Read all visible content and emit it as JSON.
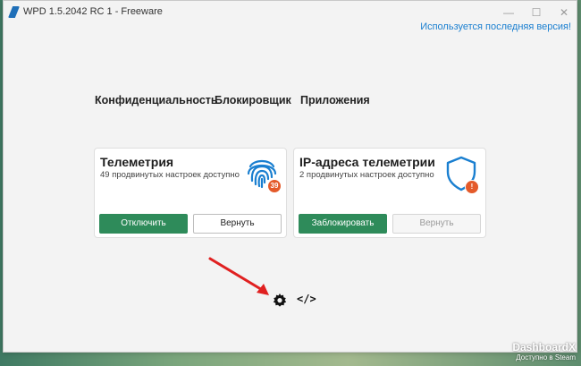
{
  "window": {
    "title": "WPD 1.5.2042 RC 1 - Freeware",
    "update_status": "Используется последняя версия!"
  },
  "nav": {
    "items": [
      {
        "label": "Конфиденциальность"
      },
      {
        "label": "Блокировщик"
      },
      {
        "label": "Приложения"
      }
    ]
  },
  "cards": [
    {
      "title": "Телеметрия",
      "subtitle": "49 продвинутых настроек доступно",
      "icon": "fingerprint-icon",
      "badge": "39",
      "primary_button": "Отключить",
      "secondary_button": "Вернуть"
    },
    {
      "title": "IP-адреса телеметрии",
      "subtitle": "2 продвинутых настроек доступно",
      "icon": "shield-icon",
      "badge": "!",
      "primary_button": "Заблокировать",
      "secondary_button": "Вернуть"
    }
  ],
  "footer_icons": [
    "gear-icon",
    "code-icon"
  ],
  "code_glyph": "</>",
  "watermark": {
    "title": "DashboardX",
    "subtitle": "Доступно в Steam"
  },
  "colors": {
    "accent": "#2e8b5a",
    "link": "#1a7fd0",
    "icon_blue": "#1a7fd0",
    "badge": "#e45a2a",
    "arrow": "#e02020"
  }
}
